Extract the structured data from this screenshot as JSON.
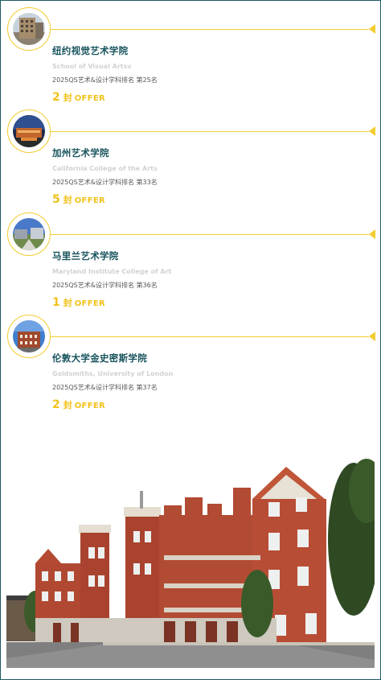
{
  "colors": {
    "accent": "#f2cc2e",
    "title": "#17535c",
    "offer": "#f2c21a",
    "border": "#1f5a62"
  },
  "schools": [
    {
      "name_cn": "纽约视觉艺术学院",
      "name_en": "School of Visual Artsv",
      "rank": "2025QS艺术&设计学科排名 第25名",
      "offer_count": "2",
      "offer_unit": "封",
      "offer_word": "OFFER"
    },
    {
      "name_cn": "加州艺术学院",
      "name_en": "California College of the Arts",
      "rank": "2025QS艺术&设计学科排名 第33名",
      "offer_count": "5",
      "offer_unit": "封",
      "offer_word": "OFFER"
    },
    {
      "name_cn": "马里兰艺术学院",
      "name_en": "Maryland Institute College of Art",
      "rank": "2025QS艺术&设计学科排名 第36名",
      "offer_count": "1",
      "offer_unit": "封",
      "offer_word": "OFFER"
    },
    {
      "name_cn": "伦敦大学金史密斯学院",
      "name_en": "Goldsmiths, University of London",
      "rank": "2025QS艺术&设计学科排名 第37名",
      "offer_count": "2",
      "offer_unit": "封",
      "offer_word": "OFFER"
    }
  ]
}
